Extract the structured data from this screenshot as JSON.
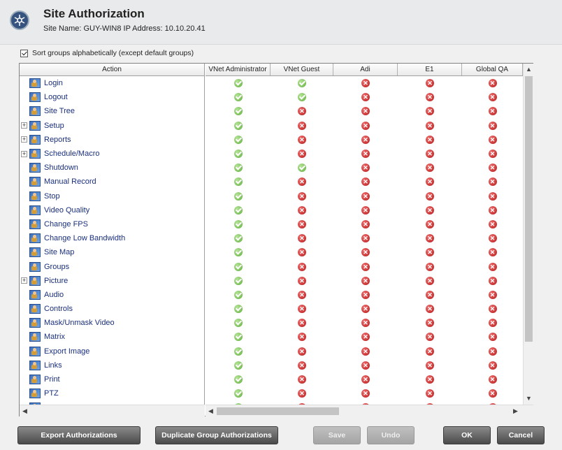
{
  "header": {
    "title": "Site Authorization",
    "subtitle": "Site Name: GUY-WIN8   IP Address: 10.10.20.41"
  },
  "sort_label": "Sort groups alphabetically (except default groups)",
  "columns": {
    "action": "Action",
    "groups": [
      "VNet Administrator",
      "VNet Guest",
      "Adi",
      "E1",
      "Global QA"
    ]
  },
  "rows": [
    {
      "label": "Login",
      "expand": false,
      "perms": [
        "ok",
        "ok",
        "no",
        "no",
        "no"
      ]
    },
    {
      "label": "Logout",
      "expand": false,
      "perms": [
        "ok",
        "ok",
        "no",
        "no",
        "no"
      ]
    },
    {
      "label": "Site Tree",
      "expand": false,
      "perms": [
        "ok",
        "no",
        "no",
        "no",
        "no"
      ]
    },
    {
      "label": "Setup",
      "expand": true,
      "perms": [
        "ok",
        "no",
        "no",
        "no",
        "no"
      ]
    },
    {
      "label": "Reports",
      "expand": true,
      "perms": [
        "ok",
        "no",
        "no",
        "no",
        "no"
      ]
    },
    {
      "label": "Schedule/Macro",
      "expand": true,
      "perms": [
        "ok",
        "no",
        "no",
        "no",
        "no"
      ]
    },
    {
      "label": "Shutdown",
      "expand": false,
      "perms": [
        "ok",
        "ok",
        "no",
        "no",
        "no"
      ]
    },
    {
      "label": "Manual Record",
      "expand": false,
      "perms": [
        "ok",
        "no",
        "no",
        "no",
        "no"
      ]
    },
    {
      "label": "Stop",
      "expand": false,
      "perms": [
        "ok",
        "no",
        "no",
        "no",
        "no"
      ]
    },
    {
      "label": "Video Quality",
      "expand": false,
      "perms": [
        "ok",
        "no",
        "no",
        "no",
        "no"
      ]
    },
    {
      "label": "Change FPS",
      "expand": false,
      "perms": [
        "ok",
        "no",
        "no",
        "no",
        "no"
      ]
    },
    {
      "label": "Change Low Bandwidth",
      "expand": false,
      "perms": [
        "ok",
        "no",
        "no",
        "no",
        "no"
      ]
    },
    {
      "label": "Site Map",
      "expand": false,
      "perms": [
        "ok",
        "no",
        "no",
        "no",
        "no"
      ]
    },
    {
      "label": "Groups",
      "expand": false,
      "perms": [
        "ok",
        "no",
        "no",
        "no",
        "no"
      ]
    },
    {
      "label": "Picture",
      "expand": true,
      "perms": [
        "ok",
        "no",
        "no",
        "no",
        "no"
      ]
    },
    {
      "label": "Audio",
      "expand": false,
      "perms": [
        "ok",
        "no",
        "no",
        "no",
        "no"
      ]
    },
    {
      "label": "Controls",
      "expand": false,
      "perms": [
        "ok",
        "no",
        "no",
        "no",
        "no"
      ]
    },
    {
      "label": "Mask/Unmask Video",
      "expand": false,
      "perms": [
        "ok",
        "no",
        "no",
        "no",
        "no"
      ]
    },
    {
      "label": "Matrix",
      "expand": false,
      "perms": [
        "ok",
        "no",
        "no",
        "no",
        "no"
      ]
    },
    {
      "label": "Export Image",
      "expand": false,
      "perms": [
        "ok",
        "no",
        "no",
        "no",
        "no"
      ]
    },
    {
      "label": "Links",
      "expand": false,
      "perms": [
        "ok",
        "no",
        "no",
        "no",
        "no"
      ]
    },
    {
      "label": "Print",
      "expand": false,
      "perms": [
        "ok",
        "no",
        "no",
        "no",
        "no"
      ]
    },
    {
      "label": "PTZ",
      "expand": false,
      "perms": [
        "ok",
        "no",
        "no",
        "no",
        "no"
      ]
    },
    {
      "label": "",
      "expand": false,
      "perms": [
        "ok",
        "no",
        "no",
        "no",
        "no"
      ]
    }
  ],
  "buttons": {
    "export": "Export Authorizations",
    "duplicate": "Duplicate Group Authorizations",
    "save": "Save",
    "undo": "Undo",
    "ok": "OK",
    "cancel": "Cancel"
  },
  "icons": {
    "allowed": "green-check-icon",
    "denied": "red-x-icon",
    "scroll_up": "▲",
    "scroll_down": "▼",
    "scroll_left": "◀",
    "scroll_right": "▶"
  }
}
